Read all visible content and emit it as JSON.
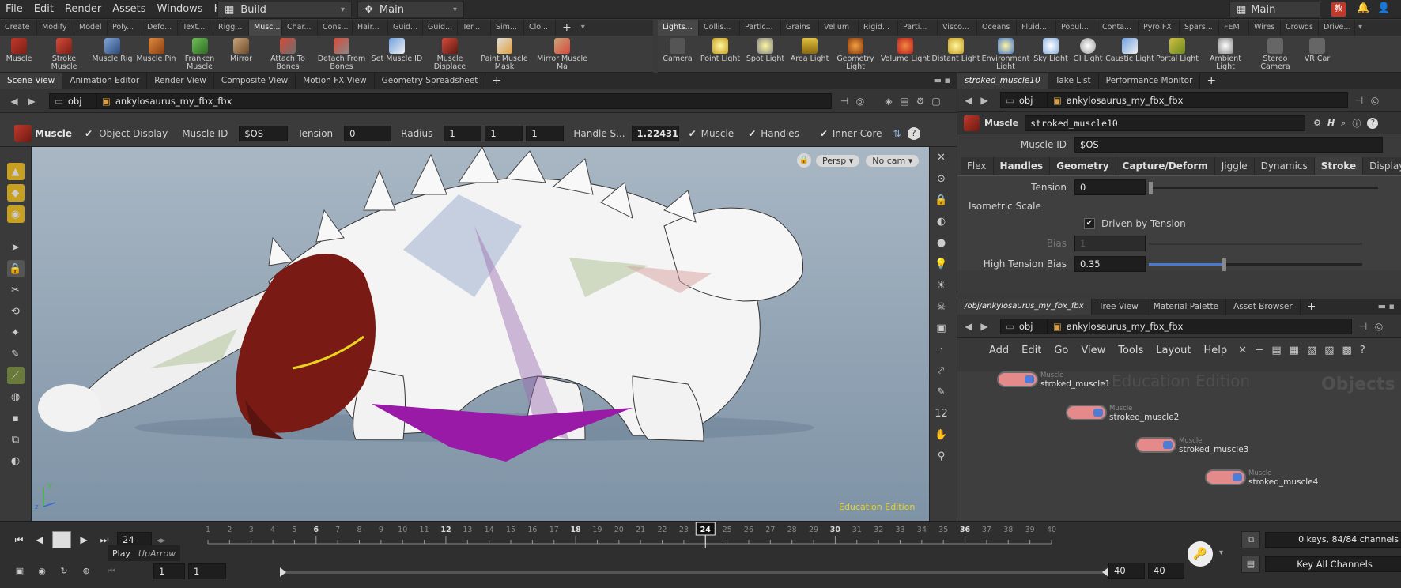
{
  "menubar": {
    "items": [
      "File",
      "Edit",
      "Render",
      "Assets",
      "Windows",
      "Help"
    ],
    "build_desk": "Build",
    "main_desk": "Main",
    "right_desk": "Main"
  },
  "shelf_left": {
    "tabs": [
      "Create",
      "Modify",
      "Model",
      "Poly...",
      "Defo...",
      "Text...",
      "Rigg...",
      "Musc...",
      "Char...",
      "Cons...",
      "Hair...",
      "Guid...",
      "Guid...",
      "Ter...",
      "Sim...",
      "Clo..."
    ],
    "active_tab": 7,
    "tools": [
      "Muscle",
      "Stroke Muscle",
      "Muscle Rig",
      "Muscle Pin",
      "Franken Muscle",
      "Mirror",
      "Attach To Bones",
      "Detach From Bones",
      "Set Muscle ID",
      "Muscle Displace",
      "Paint Muscle Mask",
      "Mirror Muscle Ma"
    ]
  },
  "shelf_right": {
    "tabs": [
      "Lights...",
      "Collis...",
      "Partic...",
      "Grains",
      "Vellum",
      "Rigid...",
      "Parti...",
      "Visco...",
      "Oceans",
      "Fluid...",
      "Popul...",
      "Conta...",
      "Pyro FX",
      "Spars...",
      "FEM",
      "Wires",
      "Crowds",
      "Drive..."
    ],
    "tools": [
      "Camera",
      "Point Light",
      "Spot Light",
      "Area Light",
      "Geometry Light",
      "Volume Light",
      "Distant Light",
      "Environment Light",
      "Sky Light",
      "GI Light",
      "Caustic Light",
      "Portal Light",
      "Ambient Light",
      "Stereo Camera",
      "VR Car"
    ]
  },
  "viewer_tabs": [
    "Scene View",
    "Animation Editor",
    "Render View",
    "Composite View",
    "Motion FX View",
    "Geometry Spreadsheet"
  ],
  "viewer_path": {
    "obj": "obj",
    "node": "ankylosaurus_my_fbx_fbx"
  },
  "muscle_toolbar": {
    "tool": "Muscle",
    "object_display": "Object Display",
    "muscle_id_label": "Muscle ID",
    "muscle_id_value": "$OS",
    "tension_label": "Tension",
    "tension_value": "0",
    "radius_label": "Radius",
    "radius_values": [
      "1",
      "1",
      "1"
    ],
    "handle_label": "Handle S...",
    "handle_value": "1.22431",
    "muscle_toggle": "Muscle",
    "handles_toggle": "Handles",
    "inner_core_toggle": "Inner Core"
  },
  "viewport": {
    "persp": "Persp",
    "cam": "No cam",
    "watermark": "Education Edition"
  },
  "param_pane": {
    "tabs": [
      "stroked_muscle10",
      "Take List",
      "Performance Monitor"
    ],
    "path_obj": "obj",
    "path_node": "ankylosaurus_my_fbx_fbx",
    "node_type": "Muscle",
    "node_name": "stroked_muscle10",
    "muscle_id_label": "Muscle ID",
    "muscle_id_value": "$OS",
    "param_tabs": [
      "Flex",
      "Handles",
      "Geometry",
      "Capture/Deform",
      "Jiggle",
      "Dynamics",
      "Stroke",
      "Display"
    ],
    "tension_label": "Tension",
    "tension_value": "0",
    "section_label": "Isometric Scale",
    "driven_label": "Driven by Tension",
    "bias_label": "Bias",
    "bias_value": "1",
    "high_bias_label": "High Tension Bias",
    "high_bias_value": "0.35",
    "high_bias_fraction": 0.35
  },
  "network_pane": {
    "tabs": [
      "/obj/ankylosaurus_my_fbx_fbx",
      "Tree View",
      "Material Palette",
      "Asset Browser"
    ],
    "path_obj": "obj",
    "path_node": "ankylosaurus_my_fbx_fbx",
    "menu": [
      "Add",
      "Edit",
      "Go",
      "View",
      "Tools",
      "Layout",
      "Help"
    ],
    "watermark": "Education Edition",
    "context_label": "Objects",
    "nodes": [
      {
        "type": "Muscle",
        "name": "stroked_muscle1"
      },
      {
        "type": "Muscle",
        "name": "stroked_muscle2"
      },
      {
        "type": "Muscle",
        "name": "stroked_muscle3"
      },
      {
        "type": "Muscle",
        "name": "stroked_muscle4"
      }
    ]
  },
  "timeline": {
    "current_frame": "24",
    "tooltip_action": "Play",
    "tooltip_key": "UpArrow",
    "ticks": [
      "1",
      "2",
      "3",
      "4",
      "5",
      "6",
      "7",
      "8",
      "9",
      "10",
      "11",
      "12",
      "13",
      "14",
      "15",
      "16",
      "17",
      "18",
      "19",
      "20",
      "21",
      "22",
      "23",
      "24",
      "25",
      "26",
      "27",
      "28",
      "29",
      "30",
      "31",
      "32",
      "33",
      "34",
      "35",
      "36",
      "37",
      "38",
      "39",
      "40"
    ],
    "range_start": "1",
    "range_start2": "1",
    "range_end": "40",
    "range_end2": "40",
    "keys_info": "0 keys, 84/84 channels",
    "key_mode": "Key All Channels"
  },
  "colors": {
    "accent_red": "#c0392b",
    "node_body": "#e58a8a",
    "viewport_top": "#a9b7c4"
  }
}
